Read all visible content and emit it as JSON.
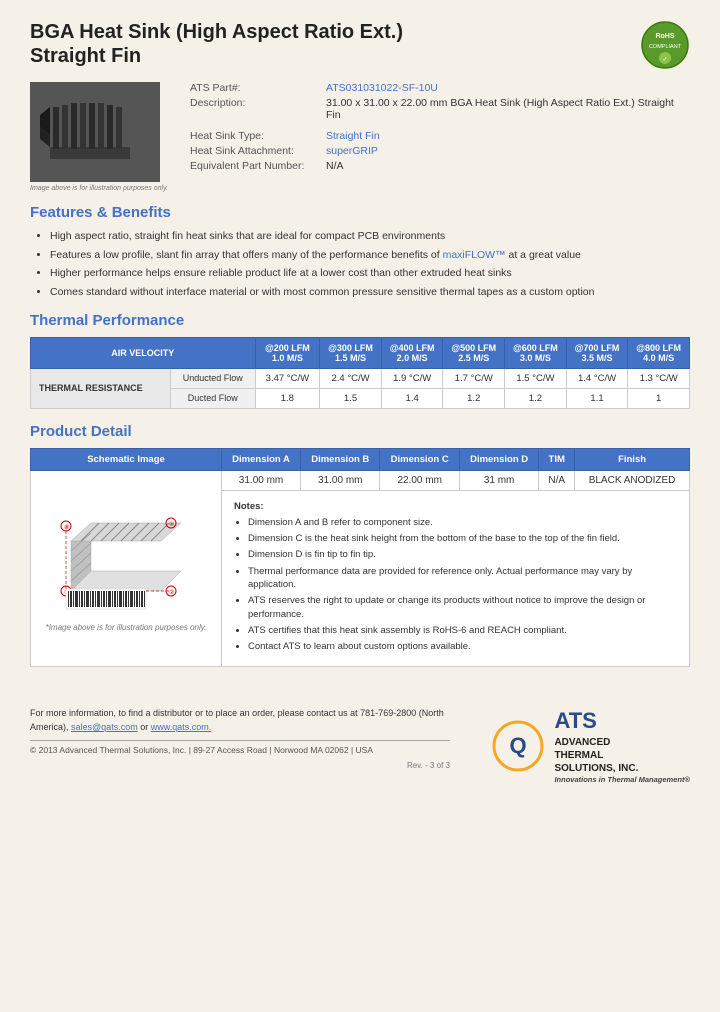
{
  "product": {
    "title_line1": "BGA Heat Sink (High Aspect Ratio Ext.)",
    "title_line2": "Straight Fin",
    "part_number": "ATS031031022-SF-10U",
    "description": "31.00 x 31.00 x 22.00 mm  BGA Heat Sink (High Aspect Ratio Ext.) Straight Fin",
    "heat_sink_type_label": "Heat Sink Type:",
    "heat_sink_type_value": "Straight Fin",
    "attachment_label": "Heat Sink Attachment:",
    "attachment_value": "superGRIP",
    "equiv_part_label": "Equivalent Part Number:",
    "equiv_part_value": "N/A",
    "ats_part_label": "ATS Part#:",
    "image_note": "Image above is for illustration purposes only."
  },
  "features": {
    "section_title": "Features & Benefits",
    "items": [
      "High aspect ratio, straight fin heat sinks that are ideal for compact PCB environments",
      "Features a low profile, slant fin array that offers many of the performance benefits of maxiFLOW™ at a great value",
      "Higher performance helps ensure reliable product life at a lower cost than other extruded heat sinks",
      "Comes standard without interface material or with most common pressure sensitive thermal tapes as a custom option"
    ]
  },
  "thermal": {
    "section_title": "Thermal Performance",
    "col_header": "AIR VELOCITY",
    "columns": [
      {
        "lfm": "@200 LFM",
        "ms": "1.0 M/S"
      },
      {
        "lfm": "@300 LFM",
        "ms": "1.5 M/S"
      },
      {
        "lfm": "@400 LFM",
        "ms": "2.0 M/S"
      },
      {
        "lfm": "@500 LFM",
        "ms": "2.5 M/S"
      },
      {
        "lfm": "@600 LFM",
        "ms": "3.0 M/S"
      },
      {
        "lfm": "@700 LFM",
        "ms": "3.5 M/S"
      },
      {
        "lfm": "@800 LFM",
        "ms": "4.0 M/S"
      }
    ],
    "row_label": "THERMAL RESISTANCE",
    "rows": [
      {
        "label": "Unducted Flow",
        "values": [
          "3.47 °C/W",
          "2.4 °C/W",
          "1.9 °C/W",
          "1.7 °C/W",
          "1.5 °C/W",
          "1.4 °C/W",
          "1.3 °C/W"
        ]
      },
      {
        "label": "Ducted Flow",
        "values": [
          "1.8",
          "1.5",
          "1.4",
          "1.2",
          "1.2",
          "1.1",
          "1"
        ]
      }
    ]
  },
  "product_detail": {
    "section_title": "Product Detail",
    "table_headers": [
      "Schematic Image",
      "Dimension A",
      "Dimension B",
      "Dimension C",
      "Dimension D",
      "TIM",
      "Finish"
    ],
    "dim_values": [
      "31.00 mm",
      "31.00 mm",
      "22.00 mm",
      "31 mm",
      "N/A",
      "BLACK ANODIZED"
    ],
    "notes_title": "Notes:",
    "notes": [
      "Dimension A and B refer to component size.",
      "Dimension C is the heat sink height from the bottom of the base to the top of the fin field.",
      "Dimension D is fin tip to fin tip.",
      "Thermal performance data are provided for reference only. Actual performance may vary by application.",
      "ATS reserves the right to update or change its products without notice to improve the design or performance.",
      "ATS certifies that this heat sink assembly is RoHS-6 and REACH compliant.",
      "Contact ATS to learn about custom options available."
    ],
    "schematic_image_note": "*Image above is for illustration purposes only."
  },
  "footer": {
    "contact_text": "For more information, to find a distributor or to place an order, please contact us at 781-769-2800 (North America),",
    "email": "sales@qats.com",
    "or_text": "or",
    "website": "www.qats.com.",
    "copyright": "© 2013 Advanced Thermal Solutions, Inc.  |  89-27 Access Road  |  Norwood MA  02062  |  USA",
    "page_num": "Rev. - 3 of 3",
    "ats_line1": "ADVANCED",
    "ats_line2": "THERMAL",
    "ats_line3": "SOLUTIONS, INC.",
    "ats_tagline": "Innovations in Thermal Management®"
  }
}
